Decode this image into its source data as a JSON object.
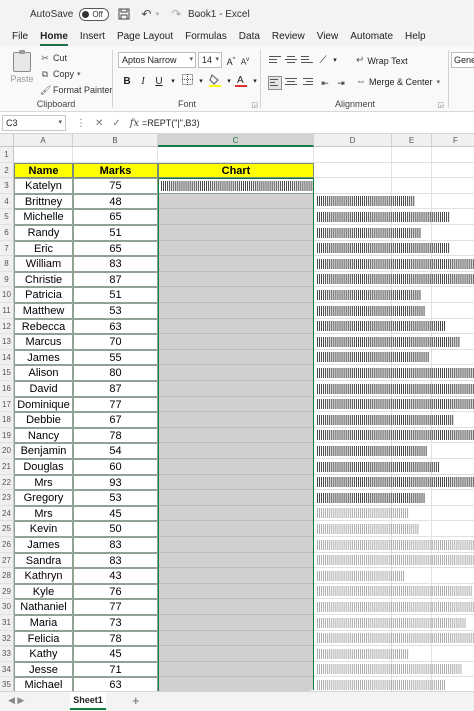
{
  "titlebar": {
    "autosave_label": "AutoSave",
    "toggle_state": "Off",
    "document_title": "Book1 - Excel"
  },
  "menu": {
    "tabs": [
      "File",
      "Home",
      "Insert",
      "Page Layout",
      "Formulas",
      "Data",
      "Review",
      "View",
      "Automate",
      "Help"
    ],
    "active": "Home"
  },
  "ribbon": {
    "clipboard": {
      "paste": "Paste",
      "cut": "Cut",
      "copy": "Copy",
      "format_painter": "Format Painter",
      "label": "Clipboard"
    },
    "font": {
      "name": "Aptos Narrow",
      "size": "14",
      "bold": "B",
      "italic": "I",
      "underline": "U",
      "label": "Font"
    },
    "alignment": {
      "wrap_text": "Wrap Text",
      "merge_center": "Merge & Center",
      "label": "Alignment"
    },
    "number": {
      "format": "Genera"
    }
  },
  "formula_bar": {
    "name_box": "C3",
    "formula": "=REPT(\"|\",B3)"
  },
  "grid": {
    "columns": [
      "A",
      "B",
      "C",
      "D",
      "E",
      "F"
    ],
    "selected_column": "C",
    "headers": {
      "name": "Name",
      "marks": "Marks",
      "chart": "Chart"
    },
    "rows": [
      {
        "row": "1",
        "name": "",
        "marks": null
      },
      {
        "row": "2",
        "name": "",
        "marks": null
      },
      {
        "row": "3",
        "name": "Katelyn",
        "marks": 75
      },
      {
        "row": "4",
        "name": "Brittney",
        "marks": 48
      },
      {
        "row": "5",
        "name": "Michelle",
        "marks": 65
      },
      {
        "row": "6",
        "name": "Randy",
        "marks": 51
      },
      {
        "row": "7",
        "name": "Eric",
        "marks": 65
      },
      {
        "row": "8",
        "name": "William",
        "marks": 83
      },
      {
        "row": "9",
        "name": "Christie",
        "marks": 87
      },
      {
        "row": "10",
        "name": "Patricia",
        "marks": 51
      },
      {
        "row": "11",
        "name": "Matthew",
        "marks": 53
      },
      {
        "row": "12",
        "name": "Rebecca",
        "marks": 63
      },
      {
        "row": "13",
        "name": "Marcus",
        "marks": 70
      },
      {
        "row": "14",
        "name": "James",
        "marks": 55
      },
      {
        "row": "15",
        "name": "Alison",
        "marks": 80
      },
      {
        "row": "16",
        "name": "David",
        "marks": 87
      },
      {
        "row": "17",
        "name": "Dominique",
        "marks": 77
      },
      {
        "row": "18",
        "name": "Debbie",
        "marks": 67
      },
      {
        "row": "19",
        "name": "Nancy",
        "marks": 78
      },
      {
        "row": "20",
        "name": "Benjamin",
        "marks": 54
      },
      {
        "row": "21",
        "name": "Douglas",
        "marks": 60
      },
      {
        "row": "22",
        "name": "Mrs",
        "marks": 93
      },
      {
        "row": "23",
        "name": "Gregory",
        "marks": 53
      },
      {
        "row": "24",
        "name": "Mrs",
        "marks": 45
      },
      {
        "row": "25",
        "name": "Kevin",
        "marks": 50
      },
      {
        "row": "26",
        "name": "James",
        "marks": 83
      },
      {
        "row": "27",
        "name": "Sandra",
        "marks": 83
      },
      {
        "row": "28",
        "name": "Kathryn",
        "marks": 43
      },
      {
        "row": "29",
        "name": "Kyle",
        "marks": 76
      },
      {
        "row": "30",
        "name": "Nathaniel",
        "marks": 77
      },
      {
        "row": "31",
        "name": "Maria",
        "marks": 73
      },
      {
        "row": "32",
        "name": "Felicia",
        "marks": 78
      },
      {
        "row": "33",
        "name": "Kathy",
        "marks": 45
      },
      {
        "row": "34",
        "name": "Jesse",
        "marks": 71
      },
      {
        "row": "35",
        "name": "Michael",
        "marks": 63
      }
    ]
  },
  "sheets": {
    "tabs": [
      "Sheet1"
    ],
    "add_label": "+"
  }
}
